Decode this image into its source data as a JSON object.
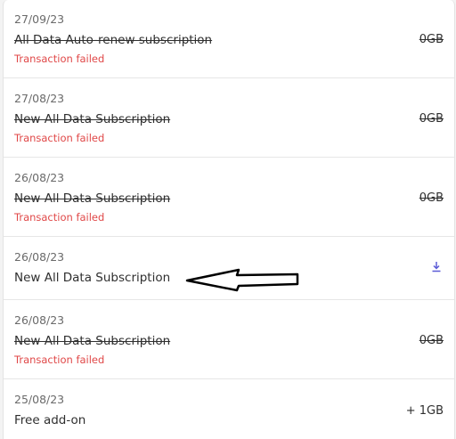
{
  "transactions": [
    {
      "date": "27/09/23",
      "title": "All Data Auto-renew subscription",
      "status": "Transaction failed",
      "amount": "0GB"
    },
    {
      "date": "27/08/23",
      "title": "New All Data Subscription",
      "status": "Transaction failed",
      "amount": "0GB"
    },
    {
      "date": "26/08/23",
      "title": "New All Data Subscription",
      "status": "Transaction failed",
      "amount": "0GB"
    },
    {
      "date": "26/08/23",
      "title": "New All Data Subscription",
      "icon": "download-icon"
    },
    {
      "date": "26/08/23",
      "title": "New All Data Subscription",
      "status": "Transaction failed",
      "amount": "0GB"
    },
    {
      "date": "25/08/23",
      "title": "Free add-on",
      "amount": "+ 1GB"
    }
  ],
  "colors": {
    "failed": "#e04848",
    "icon": "#5b5bd6"
  }
}
